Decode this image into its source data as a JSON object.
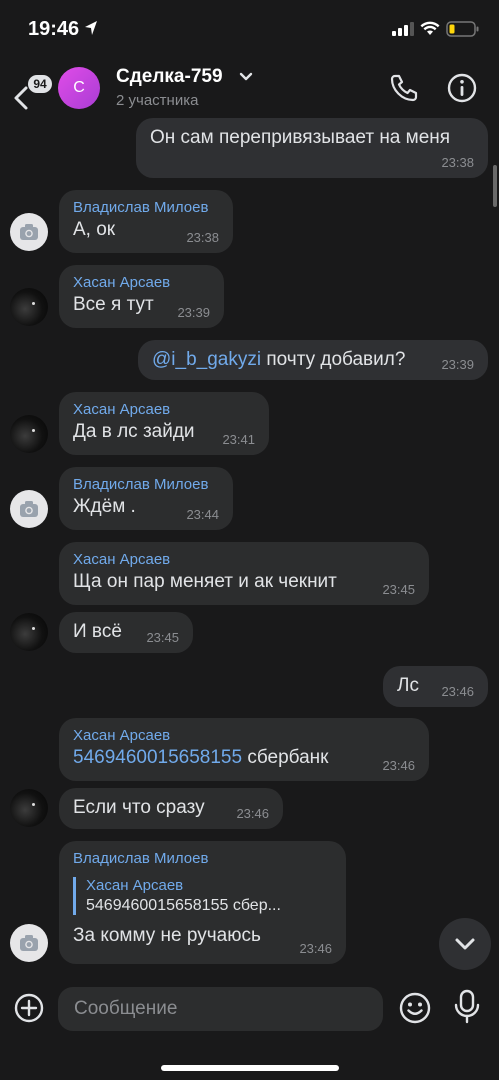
{
  "status": {
    "time": "19:46"
  },
  "header": {
    "unread_count": "94",
    "avatar_letter": "С",
    "title": "Сделка-759",
    "subtitle": "2 участника"
  },
  "messages": [
    {
      "text": "Он сам перепривязывает на меня",
      "time": "23:38"
    },
    {
      "sender": "Владислав Милоев",
      "text": "А, ок",
      "time": "23:38"
    },
    {
      "sender": "Хасан Арсаев",
      "text": "Все я тут",
      "time": "23:39"
    },
    {
      "mention": "@i_b_gakyzi",
      "text": " почту добавил?",
      "time": "23:39"
    },
    {
      "sender": "Хасан Арсаев",
      "text": "Да в лс зайди",
      "time": "23:41"
    },
    {
      "sender": "Владислав Милоев",
      "text": "Ждём .",
      "time": "23:44"
    },
    {
      "sender": "Хасан Арсаев",
      "text": "Ща он пар меняет и ак чекнит",
      "time": "23:45"
    },
    {
      "text": "И всё",
      "time": "23:45"
    },
    {
      "text": "Лс",
      "time": "23:46"
    },
    {
      "sender": "Хасан Арсаев",
      "number": "5469460015658155",
      "text": " сбербанк",
      "time": "23:46"
    },
    {
      "text": "Если что сразу",
      "time": "23:46"
    },
    {
      "sender": "Владислав Милоев",
      "quote_name": "Хасан Арсаев",
      "quote_text": "5469460015658155 сбер...",
      "text": "За комму не ручаюсь",
      "time": "23:46"
    }
  ],
  "composer": {
    "placeholder": "Сообщение"
  }
}
